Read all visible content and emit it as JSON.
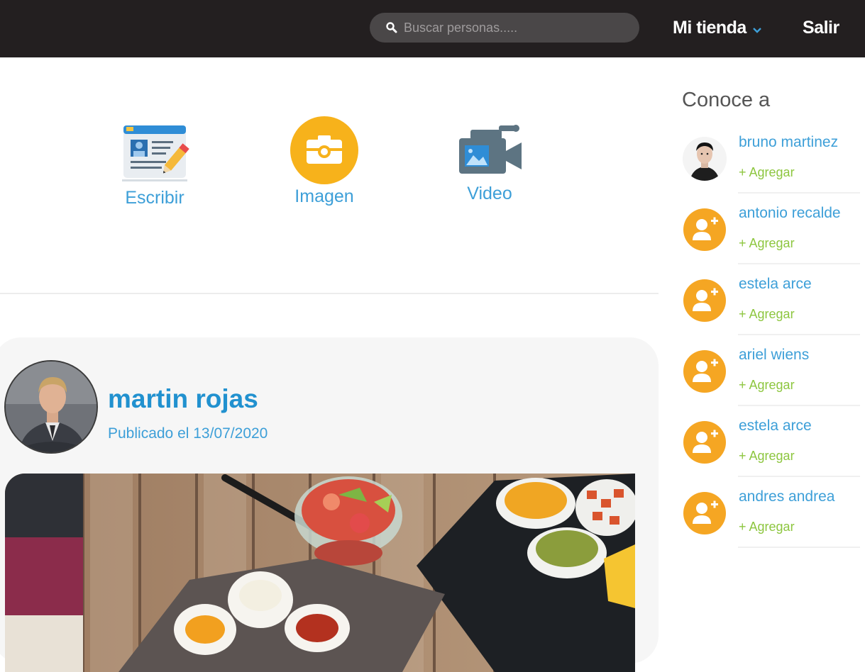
{
  "header": {
    "search_placeholder": "Buscar personas.....",
    "store_label": "Mi tienda",
    "exit_label": "Salir"
  },
  "composer": {
    "items": [
      {
        "label": "Escribir",
        "icon": "write-card-icon"
      },
      {
        "label": "Imagen",
        "icon": "camera-icon"
      },
      {
        "label": "Video",
        "icon": "video-camera-icon"
      }
    ]
  },
  "post": {
    "author": "martin rojas",
    "date": "Publicado el 13/07/2020"
  },
  "sidebar": {
    "title": "Conoce a",
    "people": [
      {
        "name": "bruno martinez",
        "add": "+ Agregar",
        "avatar": "photo"
      },
      {
        "name": "antonio recalde",
        "add": "+ Agregar",
        "avatar": "add-user-icon"
      },
      {
        "name": "estela arce",
        "add": "+ Agregar",
        "avatar": "add-user-icon"
      },
      {
        "name": "ariel wiens",
        "add": "+ Agregar",
        "avatar": "add-user-icon"
      },
      {
        "name": "estela arce",
        "add": "+ Agregar",
        "avatar": "add-user-icon"
      },
      {
        "name": "andres andrea",
        "add": "+ Agregar",
        "avatar": "add-user-icon"
      }
    ]
  },
  "colors": {
    "topbar": "#231f20",
    "link_blue": "#3d9fd8",
    "accent_orange": "#f5a623",
    "add_green": "#8dc63f"
  }
}
